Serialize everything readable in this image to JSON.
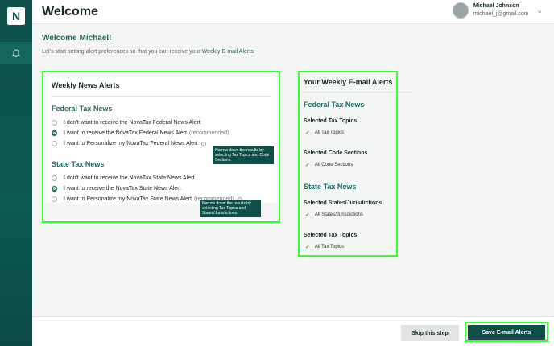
{
  "app": {
    "logo_letter": "N"
  },
  "header": {
    "title": "Welcome",
    "user_name": "Michael Johnson",
    "user_email": "michael_j@gmail.com"
  },
  "welcome": {
    "heading": "Welcome Michael!",
    "intro_prefix": "Let's start setting alert preferences so that you can receive your ",
    "intro_link": "Weekly E-mail Alerts",
    "intro_suffix": "."
  },
  "news_alerts": {
    "title": "Weekly News Alerts",
    "federal": {
      "title": "Federal Tax News",
      "options": [
        {
          "label": "I don't want to receive the NovaTax Federal News Alert",
          "rec": ""
        },
        {
          "label": "I want to receive the NovaTax Federal News Alert",
          "rec": "(recommended)"
        },
        {
          "label": "I want to Personalize my NovaTax Federal News Alert",
          "rec": ""
        }
      ],
      "selected": 1,
      "tooltip": "Narrow down the results by selecting Tax Topics and Code Sections."
    },
    "state": {
      "title": "State Tax News",
      "options": [
        {
          "label": "I don't want to receive the NovaTax State News Alert",
          "rec": ""
        },
        {
          "label": "I want to receive the NovaTax State News Alert",
          "rec": ""
        },
        {
          "label": "I want to Personalize my NovaTax State News Alert",
          "rec": "(recommended)"
        }
      ],
      "selected": 1,
      "tooltip": "Narrow down the results by selecting Tax Topics and States/Jurisdictions."
    }
  },
  "summary": {
    "title": "Your Weekly E-mail Alerts",
    "federal_title": "Federal Tax News",
    "fed_topics_label": "Selected Tax Topics",
    "fed_topics_value": "All Tax Topics",
    "fed_codes_label": "Selected Code Sections",
    "fed_codes_value": "All Code Sections",
    "state_title": "State Tax News",
    "state_juris_label": "Selected States/Jurisdictions",
    "state_juris_value": "All States/Jurisdictions",
    "state_topics_label": "Selected Tax Topics",
    "state_topics_value": "All Tax Topics"
  },
  "footer": {
    "skip_label": "Skip this step",
    "save_label": "Save  E-mail Alerts"
  },
  "colors": {
    "brand": "#0f4f4a",
    "accent": "#1a6a60",
    "highlight": "#33ff33"
  }
}
